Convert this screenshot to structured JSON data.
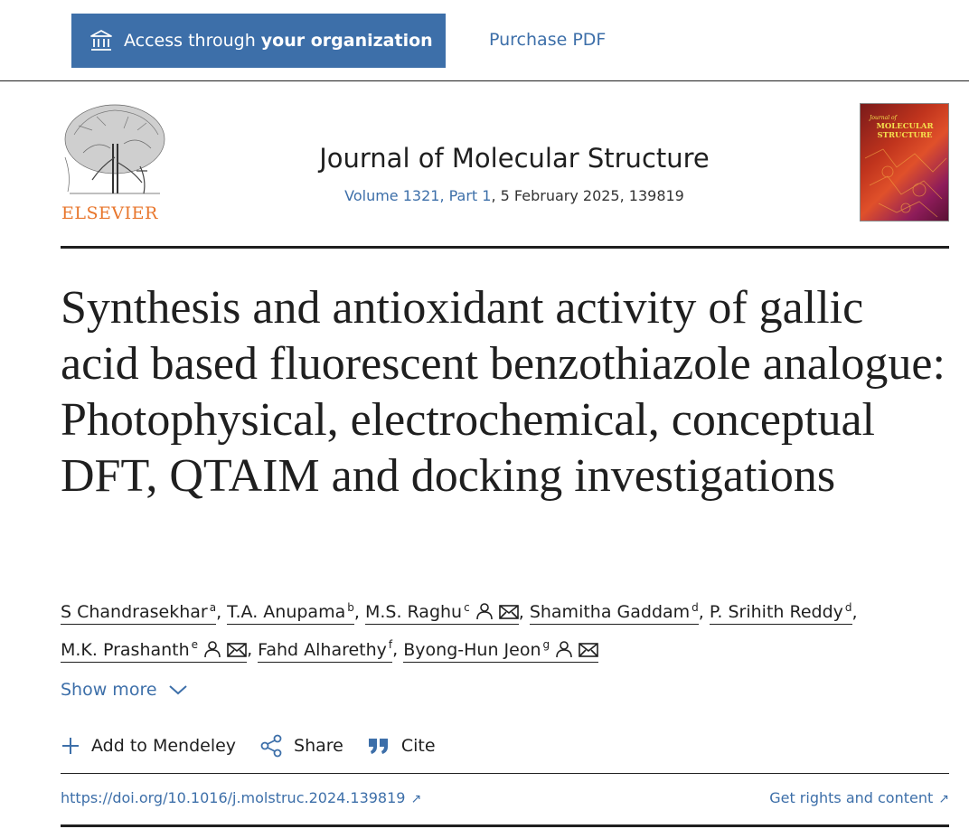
{
  "topbar": {
    "access_prefix": "Access through ",
    "access_bold": "your organization",
    "purchase_label": "Purchase PDF"
  },
  "publisher": {
    "name": "ELSEVIER"
  },
  "journal": {
    "title": "Journal of Molecular Structure",
    "volume_link": "Volume 1321, Part 1",
    "issue_rest": ", 5 February 2025, 139819",
    "cover_small": "Journal of",
    "cover_title": "MOLECULAR STRUCTURE"
  },
  "article": {
    "title": "Synthesis and antioxidant activity of gallic acid based fluorescent benzothiazole analogue: Photophysical, electrochemical, conceptual DFT, QTAIM and docking investigations"
  },
  "authors": [
    {
      "name": "S Chandrasekhar",
      "aff": "a"
    },
    {
      "name": "T.A. Anupama",
      "aff": "b"
    },
    {
      "name": "M.S. Raghu",
      "aff": "c"
    },
    {
      "name": "Shamitha Gaddam",
      "aff": "d"
    },
    {
      "name": "P. Srihith Reddy",
      "aff": "d"
    },
    {
      "name": "M.K. Prashanth",
      "aff": "e"
    },
    {
      "name": "Fahd Alharethy",
      "aff": "f"
    },
    {
      "name": "Byong-Hun Jeon",
      "aff": "g"
    }
  ],
  "separator": ",",
  "show_more_label": "Show more",
  "actions": {
    "mendeley": "Add to Mendeley",
    "share": "Share",
    "cite": "Cite"
  },
  "footer": {
    "doi": "https://doi.org/10.1016/j.molstruc.2024.139819",
    "rights": "Get rights and content"
  },
  "colors": {
    "accent": "#3d6fa9",
    "elsevier_orange": "#e8762c",
    "text": "#1f1f1f"
  }
}
